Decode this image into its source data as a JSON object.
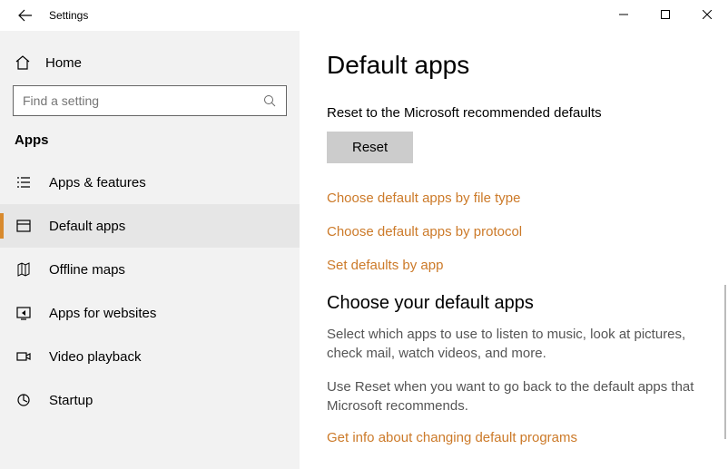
{
  "titlebar": {
    "title": "Settings"
  },
  "sidebar": {
    "home_label": "Home",
    "search_placeholder": "Find a setting",
    "section": "Apps",
    "items": [
      {
        "label": "Apps & features"
      },
      {
        "label": "Default apps"
      },
      {
        "label": "Offline maps"
      },
      {
        "label": "Apps for websites"
      },
      {
        "label": "Video playback"
      },
      {
        "label": "Startup"
      }
    ]
  },
  "main": {
    "title": "Default apps",
    "reset_label": "Reset to the Microsoft recommended defaults",
    "reset_button": "Reset",
    "links": {
      "by_file_type": "Choose default apps by file type",
      "by_protocol": "Choose default apps by protocol",
      "by_app": "Set defaults by app"
    },
    "choose_section": {
      "heading": "Choose your default apps",
      "p1": "Select which apps to use to listen to music, look at pictures, check mail, watch videos, and more.",
      "p2": "Use Reset when you want to go back to the default apps that Microsoft recommends.",
      "info_link": "Get info about changing default programs"
    }
  }
}
